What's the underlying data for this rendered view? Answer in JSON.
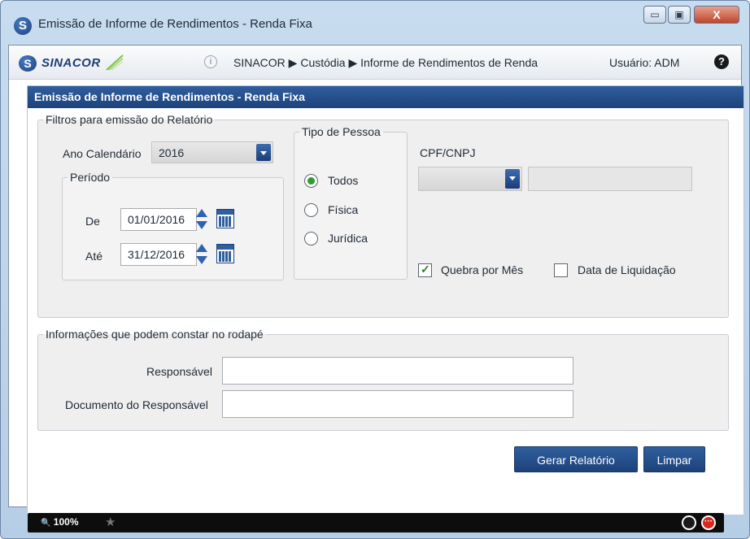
{
  "window": {
    "title": "Emissão de Informe de Rendimentos - Renda Fixa",
    "logo_letter": "S",
    "minimize_glyph": "▭",
    "maximize_glyph": "▣",
    "close_glyph": "X"
  },
  "navbar": {
    "brand": "SINACOR",
    "logo_letter": "S",
    "info_glyph": "i",
    "breadcrumb": "SINACOR ▶ Custódia ▶ Informe de Rendimentos de Renda",
    "user": "Usuário: ADM",
    "help_glyph": "?"
  },
  "panel": {
    "title": "Emissão de Informe de Rendimentos - Renda Fixa"
  },
  "filters": {
    "legend": "Filtros para emissão do Relatório",
    "ano_label": "Ano Calendário",
    "ano_value": "2016",
    "periodo_legend": "Período",
    "de_label": "De",
    "de_value": "01/01/2016",
    "ate_label": "Até",
    "ate_value": "31/12/2016",
    "tipo_legend": "Tipo de Pessoa",
    "tipo_options": [
      "Todos",
      "Física",
      "Jurídica"
    ],
    "tipo_selected": "Todos",
    "cpf_label": "CPF/CNPJ",
    "cpf_type_value": "",
    "cpf_value": "",
    "quebra_label": "Quebra por Mês",
    "quebra_checked": true,
    "liquidacao_label": "Data de Liquidação",
    "liquidacao_checked": false
  },
  "footer_info": {
    "legend": "Informações que podem constar no rodapé",
    "responsavel_label": "Responsável",
    "responsavel_value": "",
    "documento_label": "Documento do Responsável",
    "documento_value": ""
  },
  "actions": {
    "gerar": "Gerar Relatório",
    "limpar": "Limpar"
  },
  "statusbar": {
    "zoom": "100%",
    "zoom_glyph": "🔍",
    "star_glyph": "★"
  },
  "colors": {
    "header_blue": "#1d427b",
    "radio_green": "#2e9e2a"
  }
}
